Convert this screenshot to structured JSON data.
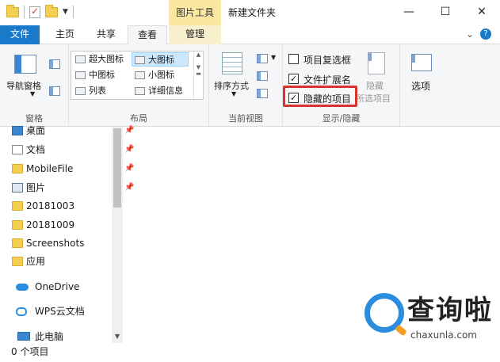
{
  "titlebar": {
    "context_tab": "图片工具",
    "window_title": "新建文件夹",
    "minimize": "—",
    "maximize": "☐",
    "close": "✕"
  },
  "tabs": {
    "file": "文件",
    "home": "主页",
    "share": "共享",
    "view": "查看",
    "manage": "管理",
    "collapse_icon": "⌄",
    "help_icon": "?"
  },
  "ribbon": {
    "panes": {
      "navigation_pane": "导航窗格",
      "label": "窗格"
    },
    "layout": {
      "items": [
        "超大图标",
        "大图标",
        "中图标",
        "小图标",
        "列表",
        "详细信息"
      ],
      "selected": "大图标",
      "label": "布局"
    },
    "current_view": {
      "sort_by": "排序方式",
      "label": "当前视图"
    },
    "show_hide": {
      "item_checkboxes": "项目复选框",
      "item_checkboxes_checked": false,
      "file_extensions": "文件扩展名",
      "file_extensions_checked": true,
      "hidden_items": "隐藏的项目",
      "hidden_items_checked": true,
      "hide_selected_line1": "隐藏",
      "hide_selected_line2": "所选项目",
      "label": "显示/隐藏"
    },
    "options": "选项"
  },
  "nav": {
    "items": [
      {
        "label": "桌面",
        "icon": "desktop-icon",
        "pinned": true
      },
      {
        "label": "文档",
        "icon": "document-icon",
        "pinned": true
      },
      {
        "label": "MobileFile",
        "icon": "folder-icon",
        "pinned": true
      },
      {
        "label": "图片",
        "icon": "picture-icon",
        "pinned": true
      },
      {
        "label": "20181003",
        "icon": "folder-icon",
        "pinned": false
      },
      {
        "label": "20181009",
        "icon": "folder-icon",
        "pinned": false
      },
      {
        "label": "Screenshots",
        "icon": "folder-icon",
        "pinned": false
      },
      {
        "label": "应用",
        "icon": "folder-icon",
        "pinned": false
      },
      {
        "label": "OneDrive",
        "icon": "cloud-icon",
        "pinned": false
      },
      {
        "label": "WPS云文档",
        "icon": "cloud-icon",
        "pinned": false
      },
      {
        "label": "此电脑",
        "icon": "computer-icon",
        "pinned": false
      }
    ]
  },
  "status": {
    "item_count": "0 个项目"
  },
  "watermark": {
    "title": "查询啦",
    "url": "chaxunla.com"
  },
  "colors": {
    "file_tab": "#1979ca",
    "context_tab": "#fbe8a0",
    "highlight": "#d9342b"
  }
}
